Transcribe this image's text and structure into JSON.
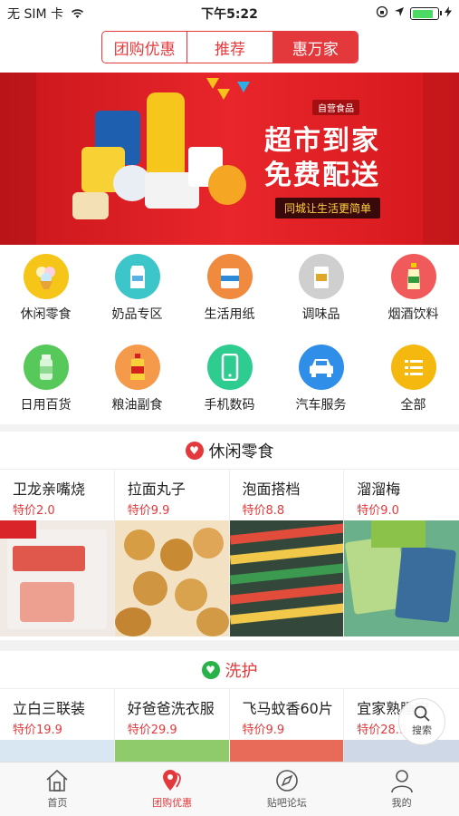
{
  "status_bar": {
    "carrier": "无 SIM 卡",
    "time": "下午5:22"
  },
  "header": {
    "tabs": [
      "团购优惠",
      "推荐",
      "惠万家"
    ],
    "active_tab": 2
  },
  "banner": {
    "brand": "自营食品",
    "title_line1": "超市到家",
    "title_line2": "免费配送",
    "slogan": "同城让生活更简单"
  },
  "categories": [
    {
      "label": "休闲零食",
      "color": "#f5c518",
      "icon": "snack-icon"
    },
    {
      "label": "奶品专区",
      "color": "#3cc6c9",
      "icon": "milk-icon"
    },
    {
      "label": "生活用纸",
      "color": "#f08a3e",
      "icon": "tissue-icon"
    },
    {
      "label": "调味品",
      "color": "#b9b9b9",
      "icon": "seasoning-icon"
    },
    {
      "label": "烟酒饮料",
      "color": "#f05a5a",
      "icon": "drink-icon"
    },
    {
      "label": "日用百货",
      "color": "#57c85a",
      "icon": "daily-goods-icon"
    },
    {
      "label": "粮油副食",
      "color": "#f59a4a",
      "icon": "oil-icon"
    },
    {
      "label": "手机数码",
      "color": "#2ecc8f",
      "icon": "phone-icon"
    },
    {
      "label": "汽车服务",
      "color": "#2f8fe8",
      "icon": "car-icon"
    },
    {
      "label": "全部",
      "color": "#f5b80f",
      "icon": "list-icon"
    }
  ],
  "sections": [
    {
      "title": "休闲零食",
      "icon_color": "#e4393c",
      "products": [
        {
          "name": "卫龙亲嘴烧",
          "price": "特价2.0",
          "bg": "#f1e9e4",
          "accent": "#e0574c"
        },
        {
          "name": "拉面丸子",
          "price": "特价9.9",
          "bg": "#f3e1c4",
          "accent": "#d79d45"
        },
        {
          "name": "泡面搭档",
          "price": "特价8.8",
          "bg": "#33483a",
          "accent": "#e24c3a"
        },
        {
          "name": "溜溜梅",
          "price": "特价9.0",
          "bg": "#6ab08a",
          "accent": "#3a6c9c"
        }
      ]
    },
    {
      "title": "洗护",
      "icon_color": "#2ab24a",
      "products": [
        {
          "name": "立白三联装",
          "price": "特价19.9"
        },
        {
          "name": "好爸爸洗衣服",
          "price": "特价29.9"
        },
        {
          "name": "飞马蚊香60片",
          "price": "特价9.9"
        },
        {
          "name": "宜家熟睡宝",
          "price": "特价28.9"
        }
      ]
    }
  ],
  "search_fab": {
    "label": "搜索"
  },
  "tabbar": [
    {
      "label": "首页",
      "icon": "home-icon"
    },
    {
      "label": "团购优惠",
      "icon": "location-icon"
    },
    {
      "label": "贴吧论坛",
      "icon": "compass-icon"
    },
    {
      "label": "我的",
      "icon": "user-icon"
    }
  ],
  "tabbar_active": 1
}
